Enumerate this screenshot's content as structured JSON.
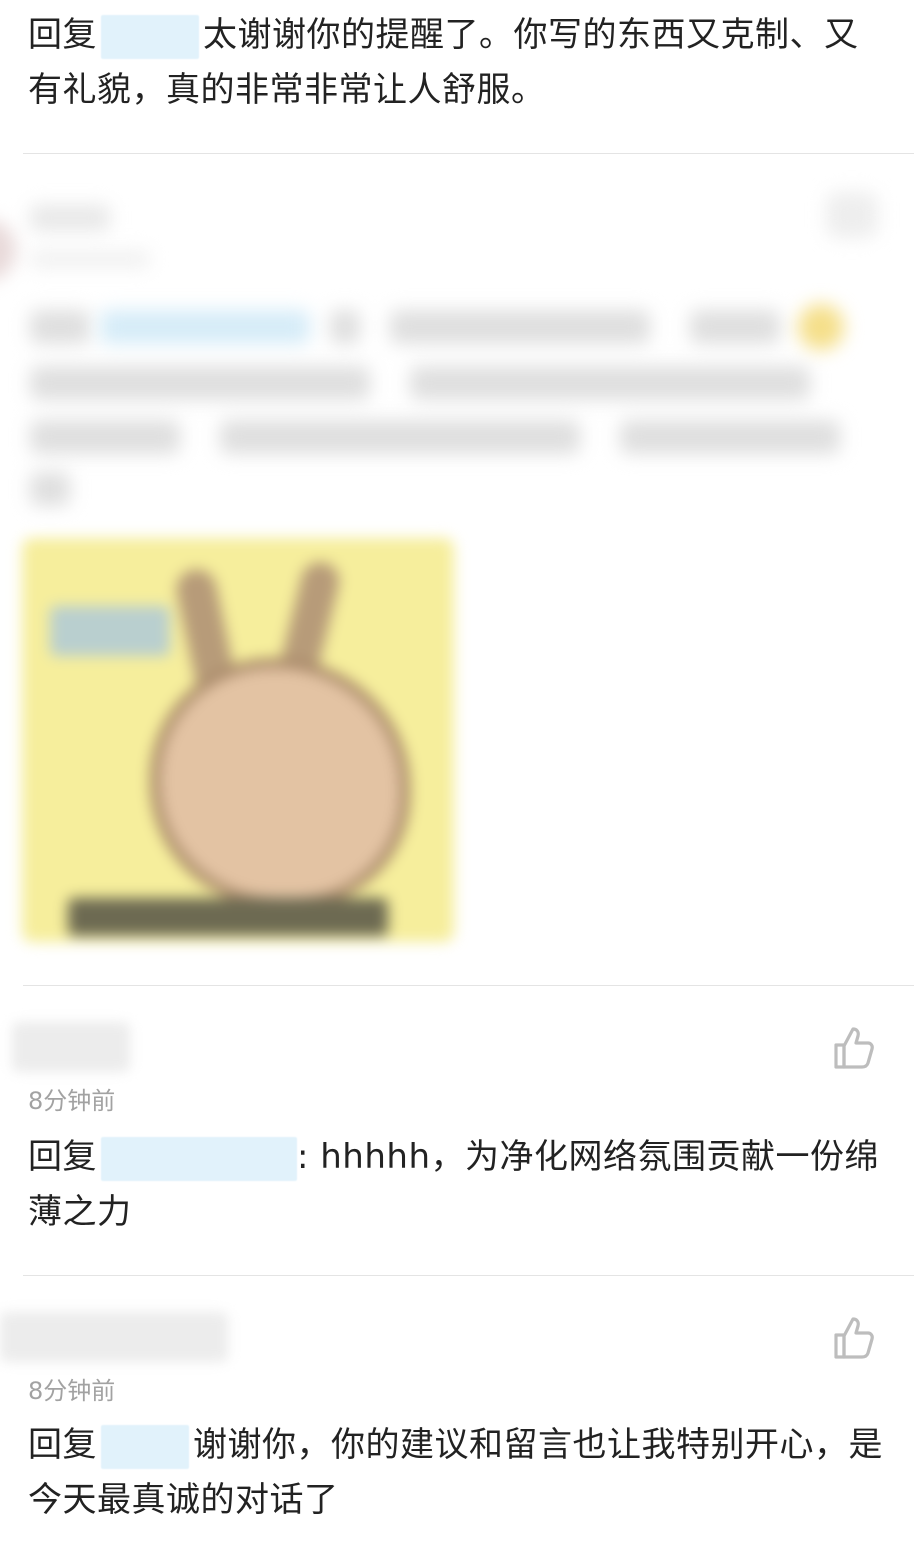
{
  "comments": [
    {
      "reply_prefix": "回复",
      "text": "太谢谢你的提醒了。你写的东西又克制、又有礼貌，真的非常非常让人舒服。"
    },
    {
      "time": "8分钟前",
      "reply_prefix": "回复",
      "text": ": hhhhh，为净化网络氛围贡献一份绵薄之力"
    },
    {
      "time": "8分钟前",
      "reply_prefix": "回复",
      "text": "谢谢你，你的建议和留言也让我特别开心，是今天最真诚的对话了"
    }
  ],
  "icons": {
    "like": "thumbs-up-icon"
  },
  "colors": {
    "mention_highlight": "#e1f2fb",
    "time_text": "#a2a2a2",
    "icon_gray": "#bdbdbd"
  }
}
